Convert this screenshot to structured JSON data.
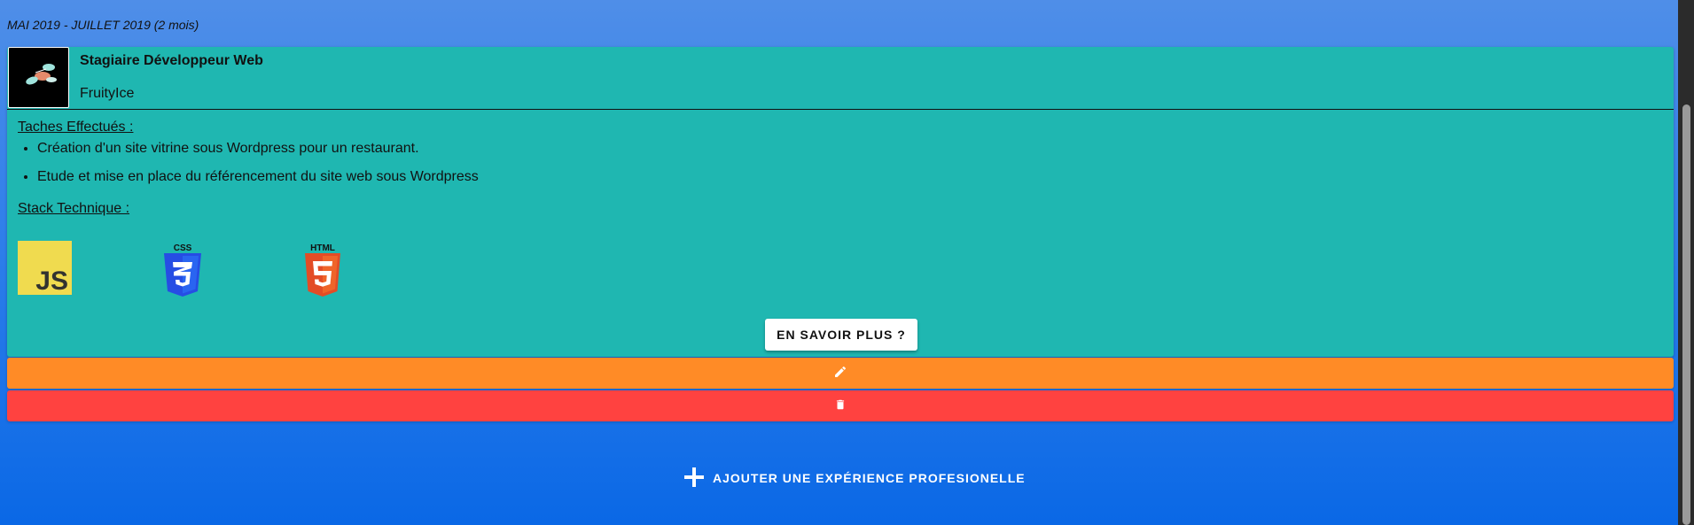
{
  "experience": {
    "date_range": "MAI 2019 - JUILLET 2019 (2 mois)",
    "job_title": "Stagiaire Développeur Web",
    "company": "FruityIce",
    "tasks_label": "Taches Effectués :",
    "tasks": [
      "Création d'un site vitrine sous Wordpress pour un restaurant.",
      "Etude et mise en place du référencement du site web sous Wordpress"
    ],
    "stack_label": "Stack Technique :",
    "stack": [
      {
        "icon": "javascript-icon",
        "text": "JS",
        "color": "#f0db4f"
      },
      {
        "icon": "css3-icon",
        "text": "CSS",
        "color": "#264de4"
      },
      {
        "icon": "html5-icon",
        "text": "HTML",
        "color": "#e34c26"
      }
    ],
    "more_button": "EN SAVOIR PLUS ?"
  },
  "actions": {
    "edit_icon": "pencil-icon",
    "delete_icon": "trash-icon",
    "add_label": "AJOUTER UNE EXPÉRIENCE PROFESIONELLE",
    "add_icon": "plus-icon"
  },
  "colors": {
    "card": "#1fb7b1",
    "edit": "#ff8b26",
    "delete": "#ff4240",
    "background": "#0a68e6"
  }
}
